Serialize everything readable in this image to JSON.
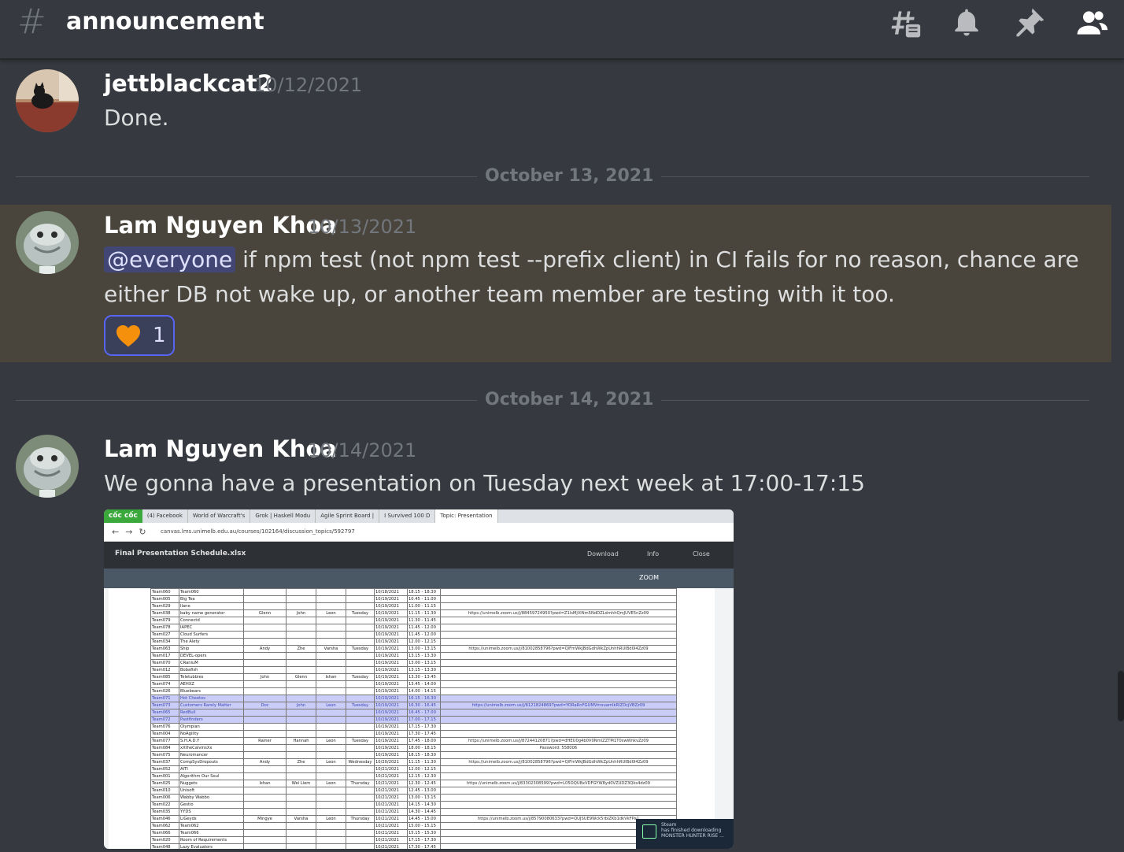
{
  "header": {
    "channel_name": "announcement",
    "icons": [
      "threads-icon",
      "bell-icon",
      "pin-icon",
      "members-icon"
    ]
  },
  "messages": [
    {
      "username": "jettblackcat2",
      "timestamp": "10/12/2021",
      "text": "Done."
    },
    {
      "username": "Lam Nguyen Khoa",
      "timestamp": "10/13/2021",
      "mention": "@everyone",
      "text": " if npm test (not npm test --prefix client) in CI fails for no reason, chance are either DB not wake up, or another team member are testing with it too.",
      "reaction": {
        "emoji": "orange-heart-icon",
        "count": "1"
      }
    },
    {
      "username": "Lam Nguyen Khoa",
      "timestamp": "10/14/2021",
      "text": "We gonna have a presentation on Tuesday next week at 17:00-17:15"
    }
  ],
  "dividers": [
    "October 13, 2021",
    "October 14, 2021"
  ],
  "attachment": {
    "browser_brand": "cốc cốc",
    "tabs": [
      "(4) Facebook",
      "World of Warcraft's",
      "Grok | Haskell Modu",
      "Agile Sprint Board |",
      "I Survived 100 D",
      "Topic: Presentation"
    ],
    "url": "canvas.lms.unimelb.edu.au/courses/102164/discussion_topics/592797",
    "file_title": "Final Presentation Schedule.xlsx",
    "actions": {
      "download": "Download",
      "info": "Info",
      "close": "Close",
      "zoom": "ZOOM"
    },
    "rows": [
      [
        "Team060",
        "Team060",
        "",
        "",
        "",
        "",
        "10/18/2021",
        "18.15 - 18.30",
        ""
      ],
      [
        "Team005",
        "Big Tea",
        "",
        "",
        "",
        "",
        "10/19/2021",
        "10.45 - 11.00",
        ""
      ],
      [
        "Team029",
        "Ilane",
        "",
        "",
        "",
        "",
        "10/19/2021",
        "11.00 - 11.15",
        ""
      ],
      [
        "Team038",
        "baby name generator",
        "Glenn",
        "John",
        "Leon",
        "Tuesday",
        "10/19/2021",
        "11.15 - 11.30",
        "https://unimelb.zoom.us/j/88459724950?pwd=Z1lsMjViNm5NdDZLdmhhQmJUVE5nZz09"
      ],
      [
        "Team079",
        "Connectd",
        "",
        "",
        "",
        "",
        "10/19/2021",
        "11.30 - 11.45",
        ""
      ],
      [
        "Team078",
        "IAPEC",
        "",
        "",
        "",
        "",
        "10/19/2021",
        "11.45 - 12.00",
        ""
      ],
      [
        "Team027",
        "Cloud Surfers",
        "",
        "",
        "",
        "",
        "10/19/2021",
        "11.45 - 12.00",
        ""
      ],
      [
        "Team034",
        "The Alety",
        "",
        "",
        "",
        "",
        "10/19/2021",
        "12.00 - 12.15",
        ""
      ],
      [
        "Team063",
        "Ship",
        "Andy",
        "Zhe",
        "Varsha",
        "Tuesday",
        "10/19/2021",
        "13.00 - 13.15",
        "https://unimelb.zoom.us/j/81002858796?pwd=QlFmWkJBdGdhWkZpUnhhRUlBd0I4Zz09"
      ],
      [
        "Team017",
        "DEVEL-opers",
        "",
        "",
        "",
        "",
        "10/19/2021",
        "13.15 - 13.30",
        ""
      ],
      [
        "Team070",
        "CRaniuM",
        "",
        "",
        "",
        "",
        "10/19/2021",
        "13.00 - 13.15",
        ""
      ],
      [
        "Team012",
        "Bobafish",
        "",
        "",
        "",
        "",
        "10/19/2021",
        "13.15 - 13.30",
        ""
      ],
      [
        "Team085",
        "Teletubbies",
        "John",
        "Glenn",
        "Ishan",
        "Tuesday",
        "10/19/2021",
        "13.30 - 13.45",
        ""
      ],
      [
        "Team074",
        "AEHXZ",
        "",
        "",
        "",
        "",
        "10/19/2021",
        "13.45 - 14.00",
        ""
      ],
      [
        "Team026",
        "Bluebears",
        "",
        "",
        "",
        "",
        "10/19/2021",
        "14.00 - 14.15",
        ""
      ],
      [
        "Team071",
        "Hot Cheetos",
        "",
        "",
        "",
        "",
        "10/19/2021",
        "16.15 - 16.30",
        ""
      ],
      [
        "Team073",
        "Customers Rarely Matter",
        "Doc",
        "John",
        "Leon",
        "Tuesday",
        "10/19/2021",
        "16.30 - 16.45",
        "https://unimelb.zoom.us/j/61218248697pwd=YORaRnFGUMVmxuamlkRlZDcjVBZz09"
      ],
      [
        "Team065",
        "RedBull",
        "",
        "",
        "",
        "",
        "10/19/2021",
        "16.45 - 17.00",
        ""
      ],
      [
        "Team072",
        "Pastfinders",
        "",
        "",
        "",
        "",
        "10/19/2021",
        "17.00 - 17.15",
        ""
      ],
      [
        "Team076",
        "Olympian",
        "",
        "",
        "",
        "",
        "10/19/2021",
        "17.15 - 17.30",
        ""
      ],
      [
        "Team004",
        "NoAgility",
        "",
        "",
        "",
        "",
        "10/19/2021",
        "17.30 - 17.45",
        ""
      ],
      [
        "Team077",
        "S.H.A.D.Y",
        "Rainer",
        "Hannah",
        "Leon",
        "Tuesday",
        "10/19/2021",
        "17.45 - 18.00",
        "https://unimelb.zoom.us/j/87244120871?pwd=dHEU0g4b0V0NmlZZTM1T0swWnkvZz09"
      ],
      [
        "Team084",
        "xXtheCalvinsXx",
        "",
        "",
        "",
        "",
        "10/19/2021",
        "18.00 - 18.15",
        "Password: 558006"
      ],
      [
        "Team075",
        "Neuromancer",
        "",
        "",
        "",
        "",
        "10/19/2021",
        "18.15 - 18.30",
        ""
      ],
      [
        "Team037",
        "CompSysDropouts",
        "Andy",
        "Zhe",
        "Leon",
        "Wednesday",
        "10/20/2021",
        "11.15 - 11.30",
        "https://unimelb.zoom.us/j/81002858796?pwd=QlFmWkJBdGdhWkZpUnhhRUlBd0I4Zz09"
      ],
      [
        "Team052",
        "AITI",
        "",
        "",
        "",
        "",
        "10/21/2021",
        "12.00 - 12.15",
        ""
      ],
      [
        "Team001",
        "Algorithm Our Soul",
        "",
        "",
        "",
        "",
        "10/21/2021",
        "12.15 - 12.30",
        ""
      ],
      [
        "Team025",
        "Nuggets",
        "Ishan",
        "Wei Liem",
        "Leon",
        "Thursday",
        "10/21/2021",
        "12.30 - 12.45",
        "https://unimelb.zoom.us/j/83302308599?pwd=L05OQU8xVDFGYW8yd0VZUDZ3Qks4dz09"
      ],
      [
        "Team010",
        "Unisoft",
        "",
        "",
        "",
        "",
        "10/21/2021",
        "12.45 - 13.00",
        ""
      ],
      [
        "Team006",
        "Wabby Wabbo",
        "",
        "",
        "",
        "",
        "10/21/2021",
        "13.00 - 13.15",
        ""
      ],
      [
        "Team022",
        "Gestio",
        "",
        "",
        "",
        "",
        "10/21/2021",
        "14.15 - 14.30",
        ""
      ],
      [
        "Team035",
        "YYDS",
        "",
        "",
        "",
        "",
        "10/21/2021",
        "14.30 - 14.45",
        ""
      ],
      [
        "Team046",
        "LiGeyds",
        "Mingye",
        "Varsha",
        "Leon",
        "Thursday",
        "10/21/2021",
        "14.45 - 15.00",
        "https://unimelb.zoom.us/j/85790080633?pwd=QUJSUE9Wck5rblZKb1dkVkFPa1"
      ],
      [
        "Team062",
        "Team062",
        "",
        "",
        "",
        "",
        "10/21/2021",
        "15.00 - 15.15",
        ""
      ],
      [
        "Team066",
        "Team066",
        "",
        "",
        "",
        "",
        "10/21/2021",
        "15.15 - 15.30",
        ""
      ],
      [
        "Team020",
        "Room of Requirements",
        "",
        "",
        "",
        "",
        "10/21/2021",
        "17.15 - 17.30",
        ""
      ],
      [
        "Team048",
        "Lazy Evaluators",
        "",
        "",
        "",
        "",
        "10/21/2021",
        "17.30 - 17.45",
        ""
      ]
    ],
    "highlight_rows": [
      15,
      16,
      17,
      18
    ],
    "toast": {
      "line1": "Steam",
      "line2": "has finished downloading",
      "line3": "MONSTER HUNTER RISE ..."
    }
  },
  "colors": {
    "accent": "#5865f2",
    "background": "#36393f",
    "highlight_bg": "#4a453c"
  }
}
